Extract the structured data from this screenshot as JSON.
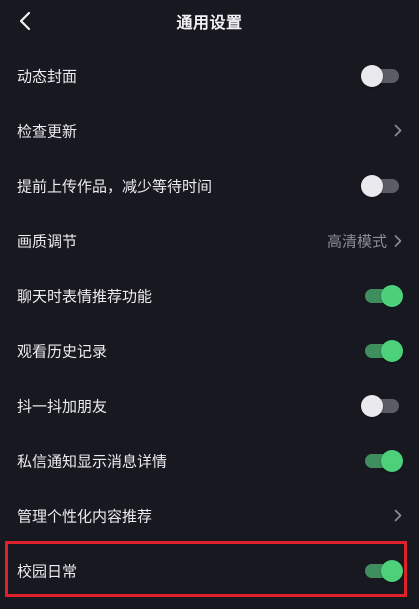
{
  "header": {
    "title": "通用设置",
    "back_icon": "chevron-left-icon"
  },
  "settings": [
    {
      "label": "动态封面",
      "control": "toggle",
      "state": "off"
    },
    {
      "label": "检查更新",
      "control": "chevron"
    },
    {
      "label": "提前上传作品，减少等待时间",
      "control": "toggle",
      "state": "off"
    },
    {
      "label": "画质调节",
      "control": "chevron",
      "value": "高清模式"
    },
    {
      "label": "聊天时表情推荐功能",
      "control": "toggle",
      "state": "on"
    },
    {
      "label": "观看历史记录",
      "control": "toggle",
      "state": "on"
    },
    {
      "label": "抖一抖加朋友",
      "control": "toggle",
      "state": "off"
    },
    {
      "label": "私信通知显示消息详情",
      "control": "toggle",
      "state": "on"
    },
    {
      "label": "管理个性化内容推荐",
      "control": "chevron"
    },
    {
      "label": "校园日常",
      "control": "toggle",
      "state": "on",
      "highlighted": true
    }
  ],
  "colors": {
    "background": "#181821",
    "toggle_on_track": "#3f8f5e",
    "toggle_on_knob": "#4dd07a",
    "toggle_off_track": "#5c5c66",
    "toggle_off_knob": "#e9e9ee",
    "highlight_border": "#e0202a"
  }
}
